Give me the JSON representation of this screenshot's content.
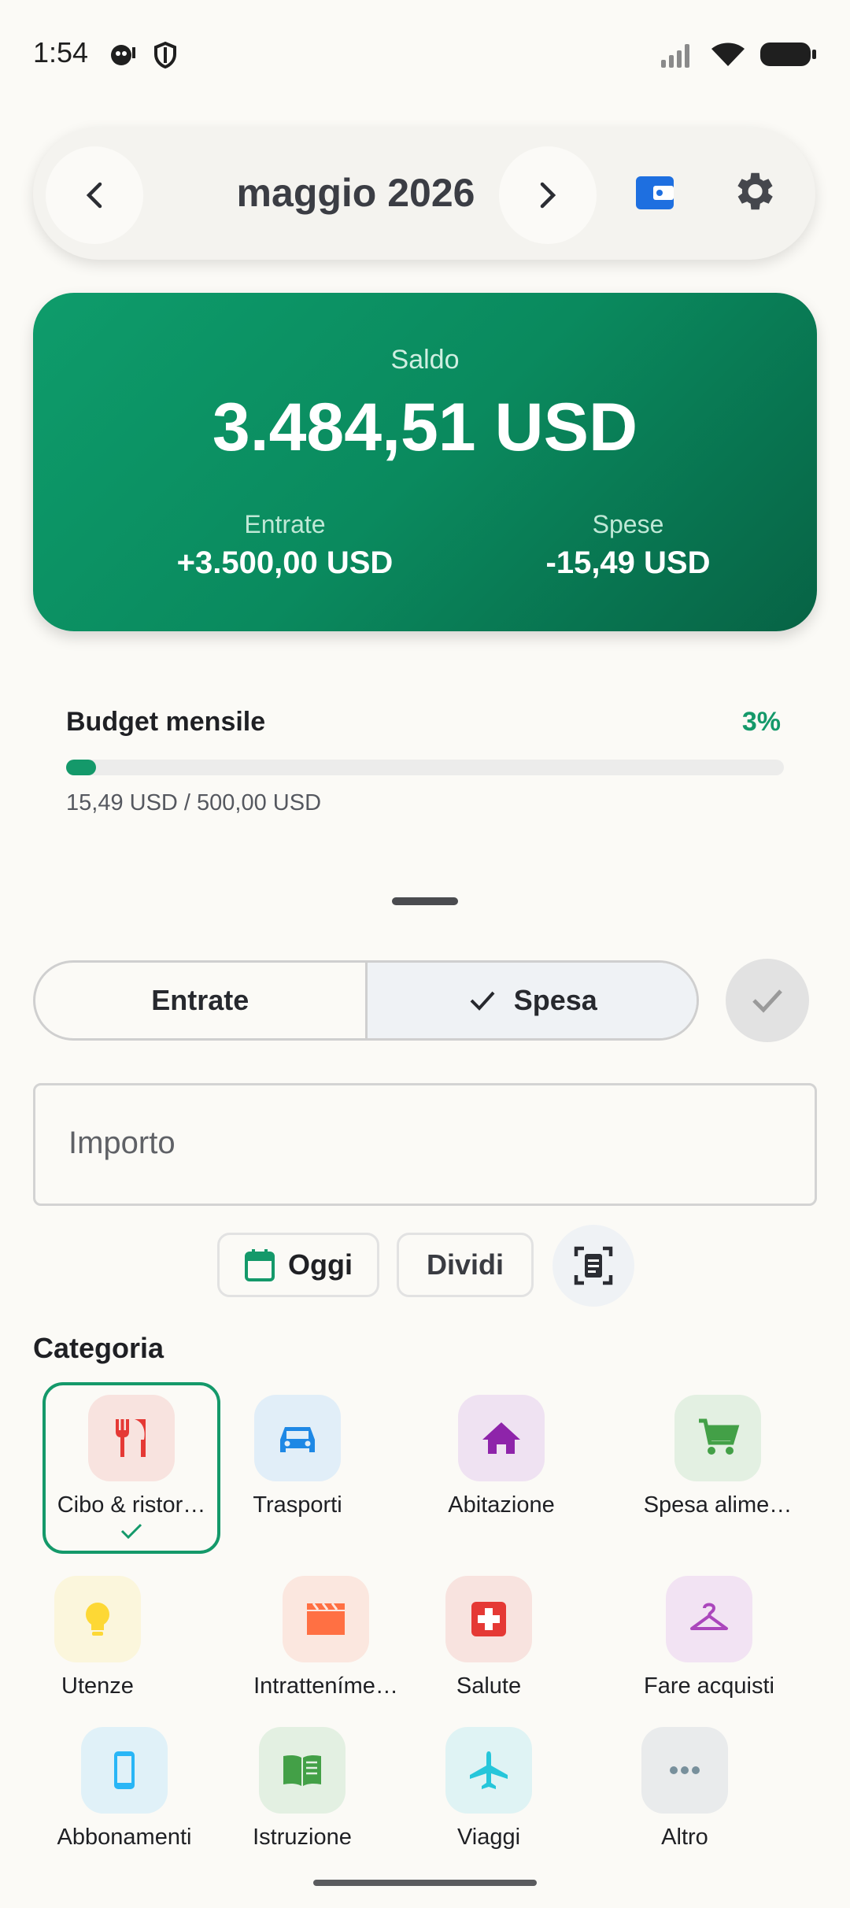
{
  "status": {
    "time": "1:54"
  },
  "header": {
    "month": "maggio 2026"
  },
  "balance": {
    "label": "Saldo",
    "amount": "3.484,51 USD",
    "income_label": "Entrate",
    "income_value": "+3.500,00 USD",
    "expense_label": "Spese",
    "expense_value": "-15,49 USD"
  },
  "budget": {
    "title": "Budget mensile",
    "percent_text": "3%",
    "progress": 0.03,
    "amounts": "15,49 USD / 500,00 USD"
  },
  "form": {
    "type_income": "Entrate",
    "type_expense": "Spesa",
    "selected_type": "expense",
    "amount_placeholder": "Importo",
    "date_chip": "Oggi",
    "split_chip": "Dividi",
    "category_title": "Categoria"
  },
  "categories": [
    {
      "label": "Cibo & ristor…",
      "icon": "restaurant-icon",
      "color": "#e53935",
      "bg": "#f8e3df",
      "selected": true
    },
    {
      "label": "Trasporti",
      "icon": "car-icon",
      "color": "#1e88e5",
      "bg": "#e1eef8"
    },
    {
      "label": "Abitazione",
      "icon": "home-icon",
      "color": "#8e24aa",
      "bg": "#efe2f2"
    },
    {
      "label": "Spesa alime…",
      "icon": "cart-icon",
      "color": "#43a047",
      "bg": "#e3f0e2"
    },
    {
      "label": "Utenze",
      "icon": "lightbulb-icon",
      "color": "#fdd835",
      "bg": "#fbf6dc"
    },
    {
      "label": "Intratteníme…",
      "icon": "clapperboard-icon",
      "color": "#ff7043",
      "bg": "#fbe7df"
    },
    {
      "label": "Salute",
      "icon": "medical-icon",
      "color": "#e53935",
      "bg": "#f8e3df"
    },
    {
      "label": "Fare acquisti",
      "icon": "hanger-icon",
      "color": "#ab47bc",
      "bg": "#f2e3f3"
    },
    {
      "label": "Abbonamenti",
      "icon": "phone-icon",
      "color": "#29b6f6",
      "bg": "#e0f1f8"
    },
    {
      "label": "Istruzione",
      "icon": "book-icon",
      "color": "#43a047",
      "bg": "#e3f0e2"
    },
    {
      "label": "Viaggi",
      "icon": "airplane-icon",
      "color": "#26c6da",
      "bg": "#dff3f4"
    },
    {
      "label": "Altro",
      "icon": "more-icon",
      "color": "#78909c",
      "bg": "#e9ebec"
    }
  ]
}
